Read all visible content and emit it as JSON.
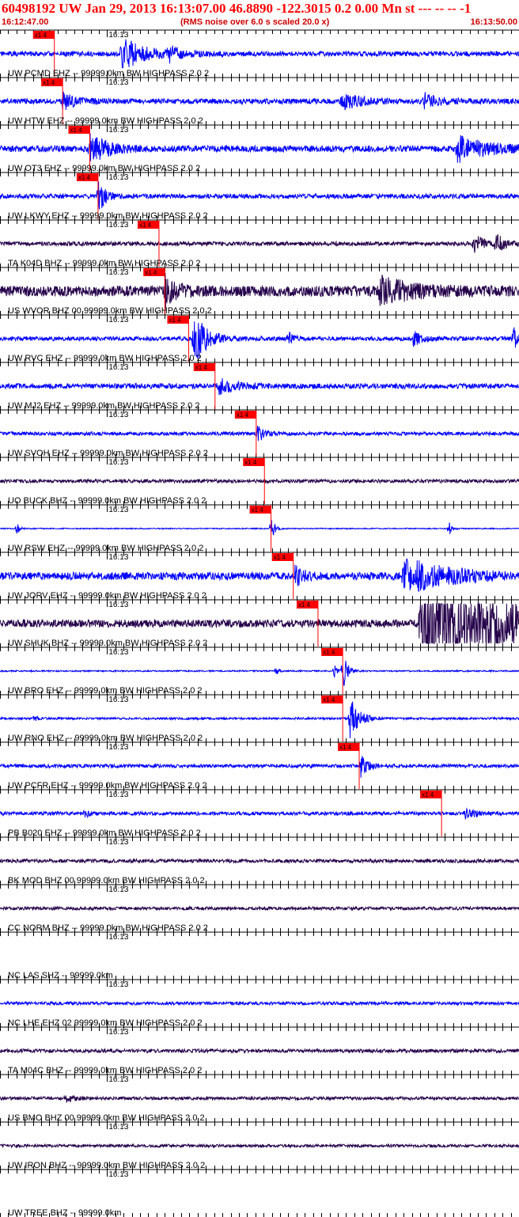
{
  "header": {
    "title": "60498192 UW Jan 29, 2013 16:13:07.00   46.8890 -122.3015  0.2 0.00 Mn st --- -- --   -1",
    "subtitle": "(RMS noise over 6.0 s scaled 20.0 x)",
    "start_time": "16:12:47.00",
    "end_time": "16:13:50.00"
  },
  "chart_data": {
    "type": "line",
    "title": "60498192 UW Jan 29, 2013 16:13:07.00   46.8890 -122.3015  0.2 0.00 Mn st --- -- --   -1",
    "subtitle": "(RMS noise over 6.0 s scaled 20.0 x)",
    "x_range_seconds": [
      0,
      63
    ],
    "minute_tick_label": "16:13",
    "minute_tick_time_s": 13,
    "tick_interval_s": 1,
    "pick_label": "x1 4",
    "colors": {
      "title": "#ff0000",
      "pick": "#ff0000",
      "blue": "#0000ff",
      "dark": "#24004a",
      "axis": "#000000"
    },
    "traces": [
      {
        "label": "UW PCMD EHZ -- 99999.0km BW  HIGHPASS  2.0  2",
        "color": "blue",
        "pick_s": 6.6,
        "noise": 0.14,
        "seed": 11,
        "events": [
          {
            "t": 14.7,
            "amp": 1.0,
            "width": 2.5
          },
          {
            "t": 20.5,
            "amp": 0.35,
            "width": 1.5
          }
        ]
      },
      {
        "label": "UW HTW EHZ -- 99999.0km BW  HIGHPASS  2.0  2",
        "color": "blue",
        "pick_s": 7.6,
        "noise": 0.15,
        "seed": 23,
        "events": [
          {
            "t": 7.6,
            "amp": 0.45,
            "width": 1.5
          },
          {
            "t": 41.5,
            "amp": 0.5,
            "width": 2.0
          },
          {
            "t": 51.5,
            "amp": 0.45,
            "width": 1.8
          }
        ]
      },
      {
        "label": "UW OT3 EHZ -- 99999.0km BW  HIGHPASS  2.0  2",
        "color": "blue",
        "pick_s": 10.9,
        "noise": 0.18,
        "seed": 37,
        "events": [
          {
            "t": 10.9,
            "amp": 0.9,
            "width": 2.0
          },
          {
            "t": 55.5,
            "amp": 0.7,
            "width": 3.5
          }
        ]
      },
      {
        "label": "UW LKWY EHZ -- 99999.0km BW  HIGHPASS  2.0  2",
        "color": "blue",
        "pick_s": 11.9,
        "noise": 0.13,
        "seed": 41,
        "events": [
          {
            "t": 11.9,
            "amp": 1.0,
            "width": 0.8
          }
        ]
      },
      {
        "label": "TA K04D BHZ -- 99999.0km BW  HIGHPASS  2.0  2",
        "color": "dark",
        "pick_s": 19.3,
        "noise": 0.12,
        "seed": 53,
        "events": [
          {
            "t": 57.5,
            "amp": 0.6,
            "width": 1.0
          },
          {
            "t": 60.2,
            "amp": 0.55,
            "width": 1.0
          }
        ]
      },
      {
        "label": "US WVOR BHZ 00 99999.0km BW  HIGHPASS  2.0  2",
        "color": "dark",
        "pick_s": 20.0,
        "noise": 0.3,
        "seed": 67,
        "events": [
          {
            "t": 20.0,
            "amp": 0.95,
            "width": 1.2
          },
          {
            "t": 46.0,
            "amp": 0.8,
            "width": 3.5
          }
        ]
      },
      {
        "label": "UW RVC EHZ -- 99999.0km BW  HIGHPASS  2.0  2",
        "color": "blue",
        "pick_s": 22.9,
        "noise": 0.12,
        "seed": 71,
        "events": [
          {
            "t": 23.5,
            "amp": 1.6,
            "width": 1.5
          },
          {
            "t": 35.0,
            "amp": 0.5,
            "width": 0.5
          },
          {
            "t": 50.0,
            "amp": 0.5,
            "width": 1.0
          },
          {
            "t": 62.3,
            "amp": 0.8,
            "width": 0.4
          }
        ]
      },
      {
        "label": "UW MJ2 EHZ -- 99999.0km BW  HIGHPASS  2.0  2",
        "color": "blue",
        "pick_s": 26.1,
        "noise": 0.15,
        "seed": 83,
        "events": [
          {
            "t": 26.5,
            "amp": 0.4,
            "width": 2.0
          }
        ]
      },
      {
        "label": "UW SVOH EHZ -- 99999.0km BW  HIGHPASS  2.0  2",
        "color": "blue",
        "pick_s": 31.1,
        "noise": 0.1,
        "seed": 97,
        "events": [
          {
            "t": 31.2,
            "amp": 0.55,
            "width": 0.8
          }
        ]
      },
      {
        "label": "UO BUCK BHZ -- 99999.0km BW  HIGHPASS  2.0  2",
        "color": "dark",
        "pick_s": 32.1,
        "noise": 0.1,
        "seed": 101,
        "events": []
      },
      {
        "label": "UW RSW EHZ -- 99999.0km BW  HIGHPASS  2.0  2",
        "color": "blue",
        "pick_s": 32.9,
        "noise": 0.03,
        "seed": 113,
        "events": [
          {
            "t": 2.0,
            "amp": 0.45,
            "width": 0.3
          },
          {
            "t": 32.9,
            "amp": 0.8,
            "width": 0.4
          },
          {
            "t": 54.5,
            "amp": 0.6,
            "width": 0.3
          }
        ]
      },
      {
        "label": "UW JORV EHZ -- 99999.0km BW  HIGHPASS  2.0  2",
        "color": "blue",
        "pick_s": 35.6,
        "noise": 0.22,
        "seed": 127,
        "events": [
          {
            "t": 35.8,
            "amp": 0.7,
            "width": 0.8
          },
          {
            "t": 49.0,
            "amp": 1.0,
            "width": 5.0
          }
        ]
      },
      {
        "label": "UW SHUK BHZ -- 99999.0km BW  HIGHPASS  2.0  2",
        "color": "dark",
        "pick_s": 38.6,
        "noise": 0.22,
        "seed": 131,
        "events": [
          {
            "t": 51.0,
            "amp": 2.5,
            "width": 12.0
          }
        ]
      },
      {
        "label": "UW BRO EHZ -- 99999.0km BW  HIGHPASS  2.0  2",
        "color": "blue",
        "pick_s": 41.6,
        "noise": 0.04,
        "seed": 139,
        "events": [
          {
            "t": 41.6,
            "amp": 1.2,
            "width": 0.5
          },
          {
            "t": 40.5,
            "amp": 0.4,
            "width": 0.4
          },
          {
            "t": 33.5,
            "amp": 0.3,
            "width": 0.3
          }
        ]
      },
      {
        "label": "UW RNO EHZ -- 99999.0km BW  HIGHPASS  2.0  2",
        "color": "blue",
        "pick_s": 41.6,
        "noise": 0.06,
        "seed": 149,
        "events": [
          {
            "t": 42.5,
            "amp": 1.3,
            "width": 1.0
          },
          {
            "t": 4.2,
            "amp": 0.3,
            "width": 0.3
          }
        ]
      },
      {
        "label": "UW PCFR EHZ -- 99999.0km BW  HIGHPASS  2.0  2",
        "color": "blue",
        "pick_s": 43.6,
        "noise": 0.1,
        "seed": 157,
        "events": [
          {
            "t": 43.8,
            "amp": 0.6,
            "width": 0.8
          }
        ]
      },
      {
        "label": "PB B020 EHZ -- 99999.0km BW  HIGHPASS  2.0  2",
        "color": "blue",
        "pick_s": 53.6,
        "noise": 0.1,
        "seed": 163,
        "events": [
          {
            "t": 10.3,
            "amp": 0.25,
            "width": 0.4
          },
          {
            "t": 56.5,
            "amp": 0.25,
            "width": 1.5
          }
        ]
      },
      {
        "label": "BK MOD BHZ 00 99999.0km BW  HIGHPASS  2.0  2",
        "color": "dark",
        "pick_s": null,
        "noise": 0.1,
        "seed": 173,
        "events": []
      },
      {
        "label": "CC NORM BHZ -- 99999.0km BW  HIGHPASS  2.0  2",
        "color": "dark",
        "pick_s": null,
        "noise": 0.09,
        "seed": 179,
        "events": []
      },
      {
        "label": "NC LAS SHZ -- 99999.0km",
        "color": "dark",
        "pick_s": null,
        "noise": 0.0,
        "seed": 181,
        "events": []
      },
      {
        "label": "NC LHE EHZ 02 99999.0km BW  HIGHPASS  2.0  2",
        "color": "blue",
        "pick_s": null,
        "noise": 0.09,
        "seed": 191,
        "events": []
      },
      {
        "label": "TA M04C BHZ -- 99999.0km BW  HIGHPASS  2.0  2",
        "color": "dark",
        "pick_s": null,
        "noise": 0.1,
        "seed": 193,
        "events": []
      },
      {
        "label": "US BMO BHZ 00 99999.0km BW  HIGHPASS  2.0  2",
        "color": "dark",
        "pick_s": null,
        "noise": 0.09,
        "seed": 197,
        "events": [
          {
            "t": 8.0,
            "amp": 0.25,
            "width": 1.0
          }
        ]
      },
      {
        "label": "UW IRON BHZ -- 99999.0km BW  HIGHPASS  2.0  2",
        "color": "dark",
        "pick_s": null,
        "noise": 0.08,
        "seed": 199,
        "events": []
      },
      {
        "label": "UW TREE BHZ -- 99999.0km",
        "color": "dark",
        "pick_s": null,
        "noise": 0.0,
        "seed": 211,
        "events": []
      }
    ]
  }
}
